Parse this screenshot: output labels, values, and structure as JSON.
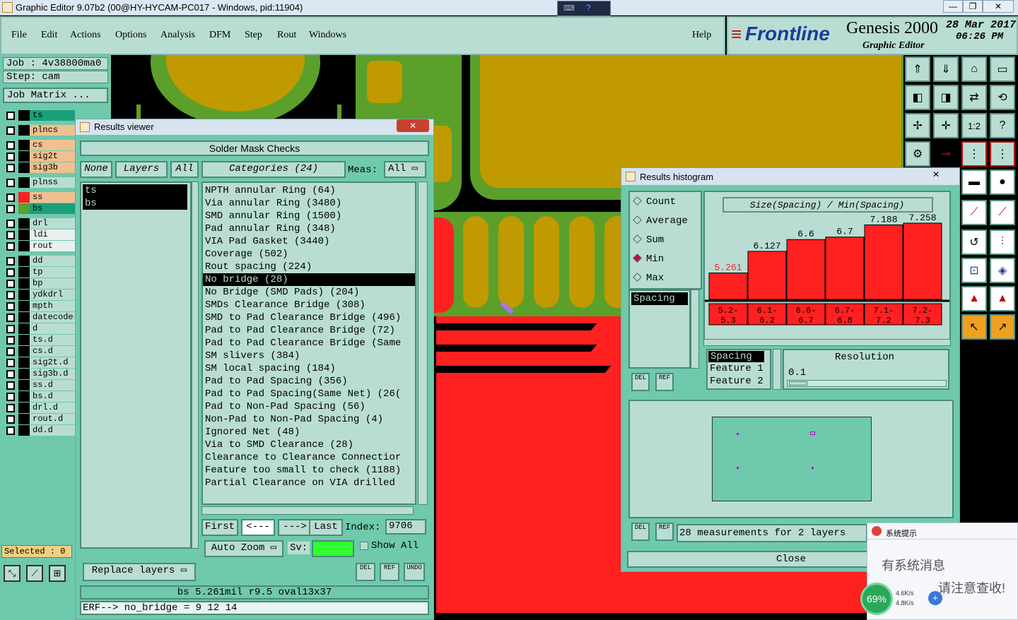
{
  "window": {
    "title": "Graphic Editor 9.07b2 (00@HY-HYCAM-PC017 - Windows, pid:11904)",
    "min_label": "—",
    "max_label": "❐",
    "close_label": "✕"
  },
  "menu": {
    "items": [
      "File",
      "Edit",
      "Actions",
      "Options",
      "Analysis",
      "DFM",
      "Step",
      "Rout",
      "Windows"
    ],
    "help": "Help"
  },
  "brand": {
    "logo_text": "Frontline",
    "product": "Genesis 2000",
    "subtitle": "Graphic Editor",
    "date": "28 Mar 2017",
    "time": "06:26 PM"
  },
  "job": {
    "job_label": "Job : 4v38800ma0",
    "step_label": "Step: cam",
    "matrix_button": "Job Matrix ..."
  },
  "layers": [
    {
      "name": "ts",
      "color": "#1a9f7a",
      "swatch": "#000000"
    },
    {
      "name": "plncs",
      "color": "#f0c090",
      "swatch": "#000000"
    },
    {
      "name": "cs",
      "color": "#f0c090",
      "swatch": "#000000"
    },
    {
      "name": "sig2t",
      "color": "#f0c090",
      "swatch": "#000000"
    },
    {
      "name": "sig3b",
      "color": "#f0c090",
      "swatch": "#000000"
    },
    {
      "name": "plnss",
      "color": "#b9ddd3",
      "swatch": "#000000"
    },
    {
      "name": "ss",
      "color": "#f0c090",
      "swatch": "#ff2020"
    },
    {
      "name": "bs",
      "color": "#1a9f7a",
      "swatch": "#5aa02a"
    },
    {
      "name": "drl",
      "color": "#b9ddd3",
      "swatch": "#000000"
    },
    {
      "name": "ldi",
      "color": "#e8f0f0",
      "swatch": "#000000"
    },
    {
      "name": "rout",
      "color": "#e8f0f0",
      "swatch": "#000000"
    },
    {
      "name": "dd",
      "color": "#b9ddd3",
      "swatch": "#000000"
    },
    {
      "name": "tp",
      "color": "#b9ddd3",
      "swatch": "#000000"
    },
    {
      "name": "bp",
      "color": "#b9ddd3",
      "swatch": "#000000"
    },
    {
      "name": "ydkdrl",
      "color": "#b9ddd3",
      "swatch": "#000000"
    },
    {
      "name": "mpth",
      "color": "#b9ddd3",
      "swatch": "#000000"
    },
    {
      "name": "datecode-",
      "color": "#b9ddd3",
      "swatch": "#000000"
    },
    {
      "name": "d",
      "color": "#b9ddd3",
      "swatch": "#000000"
    },
    {
      "name": "ts.d",
      "color": "#b9ddd3",
      "swatch": "#000000"
    },
    {
      "name": "cs.d",
      "color": "#b9ddd3",
      "swatch": "#000000"
    },
    {
      "name": "sig2t.d",
      "color": "#b9ddd3",
      "swatch": "#000000"
    },
    {
      "name": "sig3b.d",
      "color": "#b9ddd3",
      "swatch": "#000000"
    },
    {
      "name": "ss.d",
      "color": "#b9ddd3",
      "swatch": "#000000"
    },
    {
      "name": "bs.d",
      "color": "#b9ddd3",
      "swatch": "#000000"
    },
    {
      "name": "drl.d",
      "color": "#b9ddd3",
      "swatch": "#000000"
    },
    {
      "name": "rout.d",
      "color": "#b9ddd3",
      "swatch": "#000000"
    },
    {
      "name": "dd.d",
      "color": "#b9ddd3",
      "swatch": "#000000"
    }
  ],
  "selected_label": "Selected : 0",
  "results_viewer": {
    "title": "Results viewer",
    "header": "Solder Mask Checks",
    "none_btn": "None",
    "layers_btn": "Layers",
    "all_btn": "All",
    "layer_items": [
      "ts",
      "bs"
    ],
    "categories_label": "Categories (24)",
    "meas_label": "Meas:",
    "meas_value": "All",
    "categories": [
      "NPTH annular Ring (64)",
      "Via annular Ring (3480)",
      "SMD annular Ring (1500)",
      "Pad annular Ring (348)",
      "VIA Pad Gasket (3440)",
      "Coverage (502)",
      "Rout spacing (224)",
      "No bridge (28)",
      "No Bridge (SMD Pads) (204)",
      "SMDs Clearance Bridge (308)",
      "SMD to Pad Clearance Bridge (496)",
      "Pad to Pad Clearance Bridge (72)",
      "Pad to Pad Clearance Bridge (Same",
      "SM slivers (384)",
      "SM local spacing (184)",
      "Pad to Pad Spacing (356)",
      "Pad to Pad Spacing(Same Net) (26(",
      "Pad to Non-Pad Spacing (56)",
      "Non-Pad to Non-Pad Spacing (4)",
      "Ignored Net (48)",
      "Via to SMD Clearance (28)",
      "Clearance to Clearance Connectior",
      "Feature too small to check (1188)",
      "Partial Clearance on VIA drilled"
    ],
    "first_btn": "First",
    "prev_btn": "<---",
    "next_btn": "--->",
    "last_btn": "Last",
    "index_label": "Index:",
    "index_value": "9706",
    "auto_zoom": "Auto Zoom",
    "sv_label": "Sv:",
    "show_all": "Show All",
    "replace_layers": "Replace layers",
    "del_label": "DEL",
    "ref_label": "REF",
    "undo_label": "UNDO",
    "status_line": "bs 5.261mil   r9.5   oval13x37",
    "erf_line": "ERF--> no_bridge = 9 12 14"
  },
  "histogram": {
    "title": "Results histogram",
    "close_x": "✕",
    "radios": [
      {
        "label": "Count",
        "on": false
      },
      {
        "label": "Average",
        "on": false
      },
      {
        "label": "Sum",
        "on": false
      },
      {
        "label": "Min",
        "on": true
      },
      {
        "label": "Max",
        "on": false
      }
    ],
    "chart_title": "Size(Spacing) / Min(Spacing)",
    "spacing_item": "Spacing",
    "feature_items": [
      "Spacing",
      "Feature 1",
      "Feature 2"
    ],
    "resolution_label": "Resolution",
    "resolution_value": "0.1",
    "del_label": "DEL",
    "ref_label": "REF",
    "measurements": "28 measurements for 2 layers",
    "close_btn": "Close",
    "bar_color": "#ff2020"
  },
  "chart_data": {
    "type": "bar",
    "title": "Size(Spacing) / Min(Spacing)",
    "categories": [
      "5.2-5.3",
      "6.1-6.2",
      "6.6-6.7",
      "6.7-6.8",
      "7.1-7.2",
      "7.2-7.3"
    ],
    "category_lines": [
      [
        "5.2-",
        "5.3"
      ],
      [
        "6.1-",
        "6.2"
      ],
      [
        "6.6-",
        "6.7"
      ],
      [
        "6.7-",
        "6.8"
      ],
      [
        "7.1-",
        "7.2"
      ],
      [
        "7.2-",
        "7.3"
      ]
    ],
    "values": [
      5.261,
      6.127,
      6.6,
      6.7,
      7.188,
      7.258
    ],
    "value_labels": [
      "5.261",
      "6.127",
      "6.6",
      "6.7",
      "7.188",
      "7.258"
    ],
    "highlight_index": 0,
    "ylim": [
      0,
      7.258
    ]
  },
  "notification": {
    "title": "系统提示",
    "line1": "有系统消息",
    "line2": "请注意查收!",
    "cpu": "69%",
    "up": "4.6K/s",
    "down": "4.8K/s"
  }
}
